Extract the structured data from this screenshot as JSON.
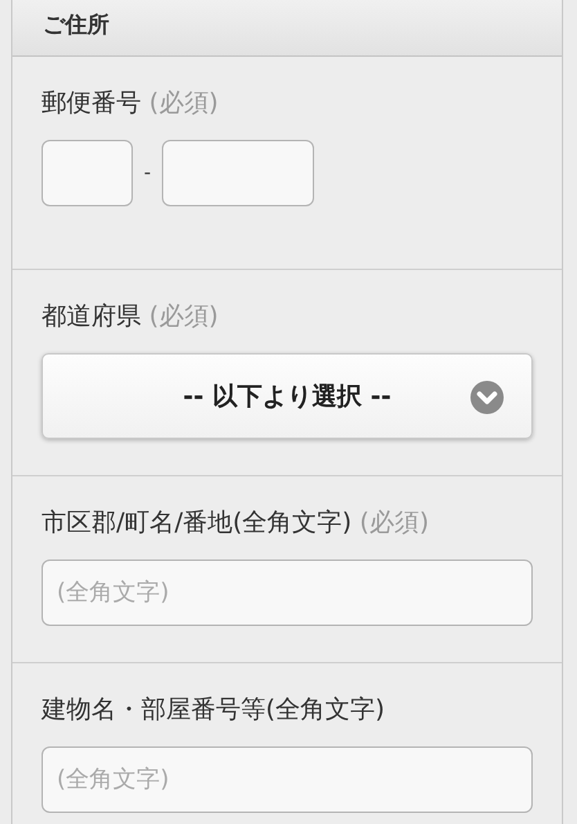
{
  "section_title": "ご住所",
  "fields": [
    {
      "kind": "postal",
      "label": "郵便番号",
      "required": "(必須)",
      "separator": "-"
    },
    {
      "kind": "select",
      "label": "都道府県",
      "required": "(必須)",
      "value": "-- 以下より選択 --"
    },
    {
      "kind": "text",
      "label": "市区郡/町名/番地(全角文字)",
      "required": "(必須)",
      "placeholder": "(全角文字)"
    },
    {
      "kind": "text",
      "label": "建物名・部屋番号等(全角文字)",
      "placeholder": "(全角文字)"
    }
  ]
}
